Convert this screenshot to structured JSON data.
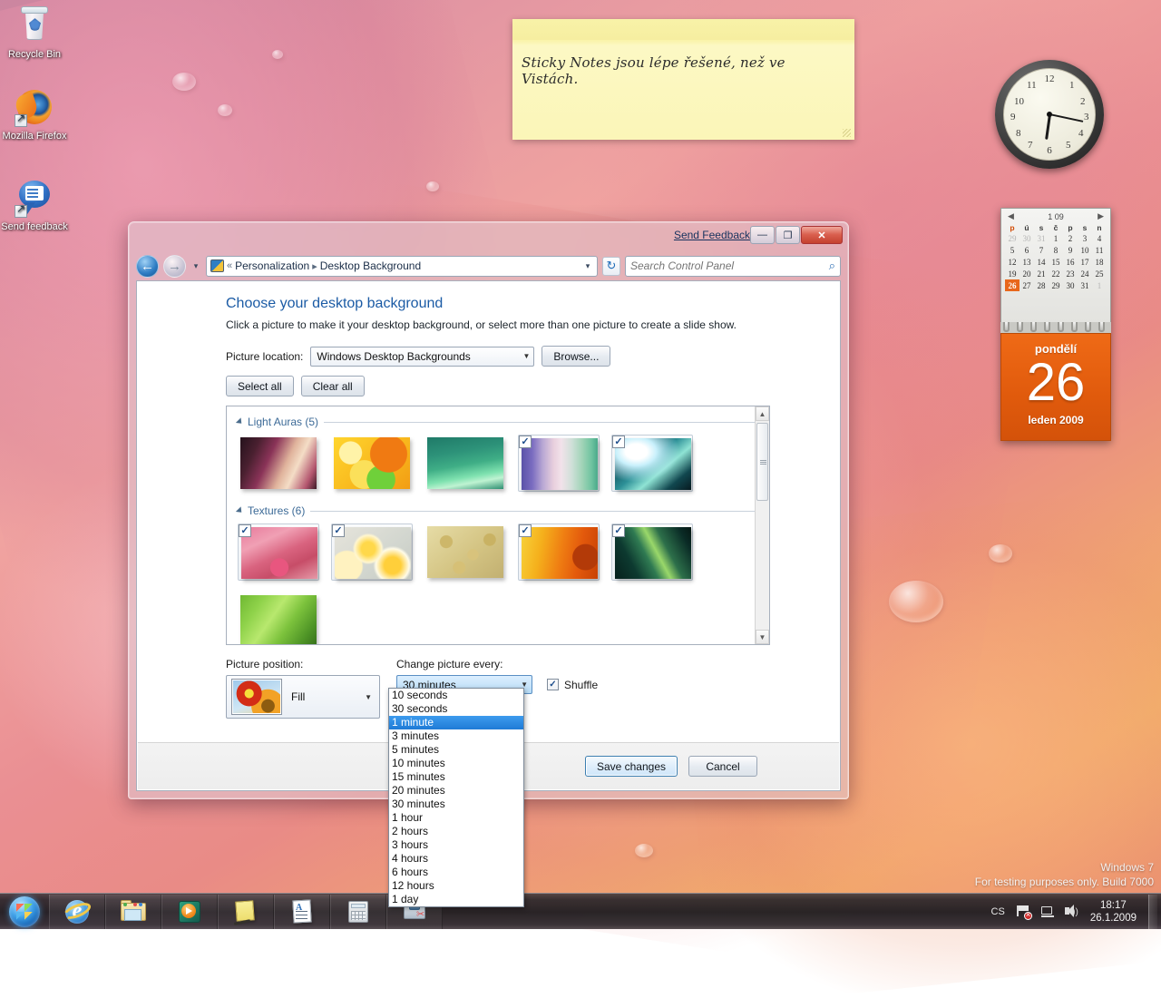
{
  "desktop": {
    "icons": [
      {
        "label": "Recycle Bin",
        "icon": "recycle-bin-icon"
      },
      {
        "label": "Mozilla Firefox",
        "icon": "firefox-icon"
      },
      {
        "label": "Send feedback",
        "icon": "send-feedback-icon"
      }
    ],
    "watermark_line1": "Windows 7",
    "watermark_line2": "For testing purposes only. Build 7000"
  },
  "sticky_note": {
    "text": "Sticky Notes jsou lépe řešené, než ve Vistách."
  },
  "clock_gadget": {
    "numbers": [
      "12",
      "1",
      "2",
      "3",
      "4",
      "5",
      "6",
      "7",
      "8",
      "9",
      "10",
      "11"
    ]
  },
  "calendar_gadget": {
    "header": "1 09",
    "prev_label": "◀",
    "next_label": "▶",
    "weekdays": [
      "p",
      "ú",
      "s",
      "č",
      "p",
      "s",
      "n"
    ],
    "weeks": [
      [
        "29",
        "30",
        "31",
        "1",
        "2",
        "3",
        "4"
      ],
      [
        "5",
        "6",
        "7",
        "8",
        "9",
        "10",
        "11"
      ],
      [
        "12",
        "13",
        "14",
        "15",
        "16",
        "17",
        "18"
      ],
      [
        "19",
        "20",
        "21",
        "22",
        "23",
        "24",
        "25"
      ],
      [
        "26",
        "27",
        "28",
        "29",
        "30",
        "31",
        "1"
      ]
    ],
    "out_of_month": [
      "0-0",
      "0-1",
      "0-2",
      "4-6"
    ],
    "today": "26",
    "day_name": "pondělí",
    "day_number": "26",
    "month_year": "leden 2009"
  },
  "window": {
    "send_feedback": "Send Feedback",
    "minimize_label": "—",
    "maximize_label": "❐",
    "close_label": "✕",
    "nav": {
      "back_label": "←",
      "forward_label": "→",
      "history_label": "▾",
      "refresh_label": "↻"
    },
    "address": {
      "prefix": "«",
      "crumb1": "Personalization",
      "separator": "▸",
      "crumb2": "Desktop Background",
      "dropdown_label": "▾"
    },
    "search": {
      "placeholder": "Search Control Panel",
      "icon": "search-icon"
    }
  },
  "page": {
    "heading": "Choose your desktop background",
    "subheading": "Click a picture to make it your desktop background, or select more than one picture to create a slide show.",
    "picture_location_label": "Picture location:",
    "picture_location_value": "Windows Desktop Backgrounds",
    "browse_label": "Browse...",
    "select_all_label": "Select all",
    "clear_all_label": "Clear all",
    "groups": [
      {
        "title": "Light Auras (5)"
      },
      {
        "title": "Textures (6)"
      }
    ],
    "picture_position_label": "Picture position:",
    "picture_position_value": "Fill",
    "change_picture_label": "Change picture every:",
    "change_picture_value": "30 minutes",
    "shuffle_label": "Shuffle",
    "shuffle_checked": "✓",
    "save_label": "Save changes",
    "cancel_label": "Cancel"
  },
  "dropdown": {
    "options": [
      "10 seconds",
      "30 seconds",
      "1 minute",
      "3 minutes",
      "5 minutes",
      "10 minutes",
      "15 minutes",
      "20 minutes",
      "30 minutes",
      "1 hour",
      "2 hours",
      "3 hours",
      "4 hours",
      "6 hours",
      "12 hours",
      "1 day"
    ],
    "highlighted": "1 minute"
  },
  "taskbar": {
    "start_label": "Start",
    "items": [
      {
        "name": "internet-explorer",
        "tooltip": "Internet Explorer"
      },
      {
        "name": "windows-explorer",
        "tooltip": "Windows Explorer"
      },
      {
        "name": "windows-media-player",
        "tooltip": "Windows Media Player"
      },
      {
        "name": "sticky-notes",
        "tooltip": "Sticky Notes"
      },
      {
        "name": "wordpad",
        "tooltip": "WordPad"
      },
      {
        "name": "calculator",
        "tooltip": "Calculator"
      },
      {
        "name": "snipping-tool",
        "tooltip": "Snipping Tool"
      }
    ],
    "tray": {
      "language": "CS",
      "time": "18:17",
      "date": "26.1.2009"
    }
  }
}
